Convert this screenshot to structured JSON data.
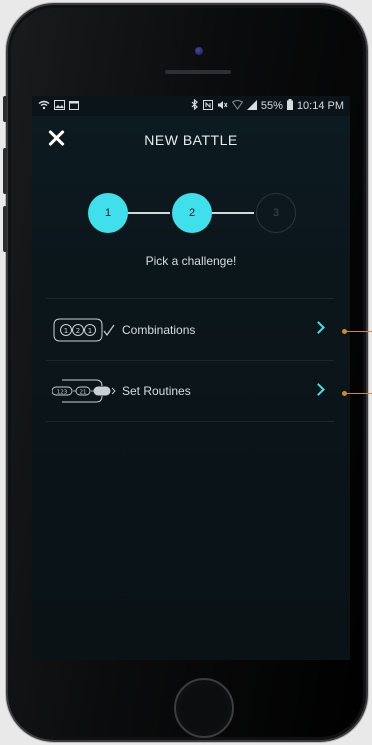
{
  "statusbar": {
    "left_icons": [
      "wifi-icon",
      "image-icon",
      "calendar-icon"
    ],
    "right_icons": [
      "bluetooth-icon",
      "nfc-icon",
      "mute-icon",
      "wifi-signal-icon",
      "cell-signal-icon"
    ],
    "battery": "55%",
    "time": "10:14 PM"
  },
  "header": {
    "title": "NEW BATTLE",
    "close_icon": "close-icon"
  },
  "stepper": {
    "steps": [
      {
        "label": "1",
        "state": "active"
      },
      {
        "label": "2",
        "state": "active"
      },
      {
        "label": "3",
        "state": "inactive"
      }
    ],
    "accent": "#3fe0eb"
  },
  "prompt": "Pick a challenge!",
  "options": [
    {
      "label": "Combinations",
      "icon": "combination-icon"
    },
    {
      "label": "Set Routines",
      "icon": "routine-icon"
    }
  ],
  "colors": {
    "accent": "#3fe0eb",
    "background": "#0b161b",
    "annotation": "#d4892c"
  }
}
